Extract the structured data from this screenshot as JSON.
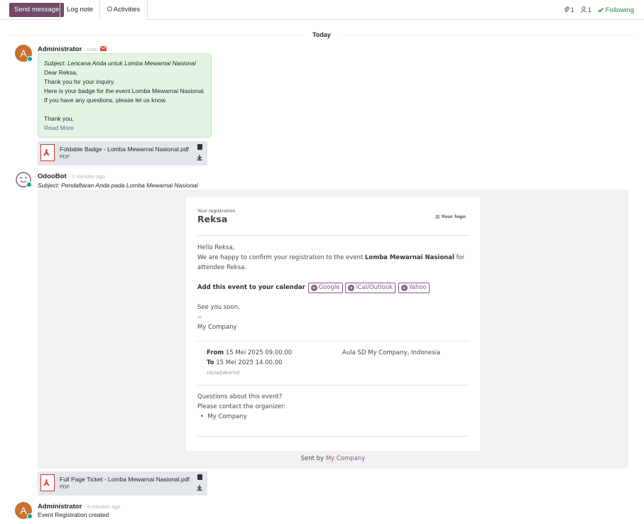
{
  "topbar": {
    "send_message": "Send message",
    "log_note": "Log note",
    "activities": "Activities",
    "attachments_count": "1",
    "followers_count": "1",
    "following": "Following"
  },
  "separator": {
    "today": "Today"
  },
  "messages": [
    {
      "avatar_letter": "A",
      "author": "Administrator",
      "time": "- now",
      "subject": "Subject: Lencana Anda untuk Lomba Mewarnai Nasional",
      "lines": [
        "Dear Reksa,",
        "Thank you for your inquiry.",
        "Here is your badge for the event Lomba Mewarnai Nasional.",
        "If you have any questions, please let us know.",
        "Thank you,"
      ],
      "read_more": "Read More",
      "attachment": {
        "name": "Foldable Badge - Lomba Mewarnai Nasional.pdf",
        "type": "PDF"
      }
    },
    {
      "author": "OdooBot",
      "time": "- 3 minutes ago",
      "subject": "Subject: Pendaftaran Anda pada Lomba Mewarnai Nasional",
      "attachment": {
        "name": "Full Page Ticket - Lomba Mewarnai Nasional.pdf",
        "type": "PDF"
      }
    },
    {
      "avatar_letter": "A",
      "author": "Administrator",
      "time": "- 4 minutes ago",
      "body": "Event Registration created"
    }
  ],
  "email": {
    "your_registration": "Your registration",
    "attendee_name": "Reksa",
    "your_logo": "Your logo",
    "hello": "Hello Reksa,",
    "confirm_prefix": "We are happy to confirm your registration to the event",
    "event_name": "Lomba Mewarnai Nasional",
    "confirm_suffix": "for attendee Reksa.",
    "add_calendar": "Add this event to your calendar",
    "google": "Google",
    "ical": "iCal/Outlook",
    "yahoo": "Yahoo",
    "see_you": "See you soon,",
    "dashes": "--",
    "company": "My Company",
    "from_label": "From",
    "from_value": "15 Mei 2025 09.00.00",
    "to_label": "To",
    "to_value": "15 Mei 2025 14.00.00",
    "timezone": "(Asia/Jakarta)",
    "location": "Aula SD My Company, Indonesia",
    "questions": "Questions about this event?",
    "contact": "Please contact the organizer:",
    "organizer": "My Company",
    "sent_by": "Sent by",
    "sent_company": "My Company"
  },
  "colors": {
    "primary": "#714b67",
    "following": "#1f8a3b",
    "note_bg": "#e3f4e5",
    "email_link": "#875a7b",
    "avatar": "#c8702e"
  }
}
